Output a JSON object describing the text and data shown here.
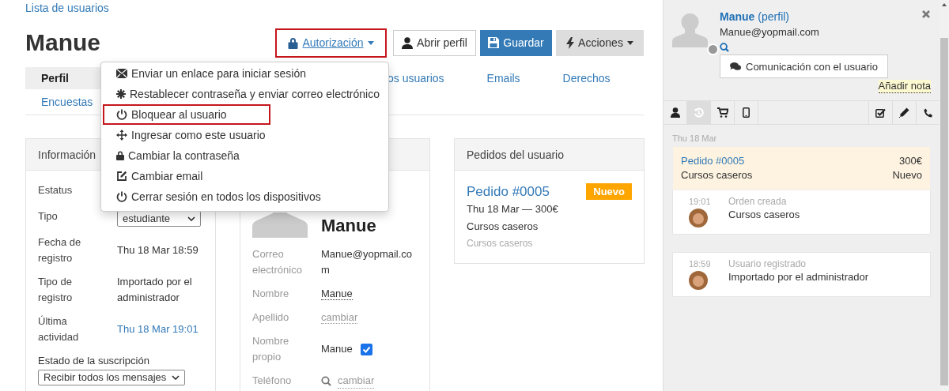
{
  "breadcrumb": "Lista de usuarios",
  "title": "Manue",
  "header_buttons": [
    {
      "label": "Autorización",
      "kind": "link",
      "highlighted": true
    },
    {
      "label": "Abrir perfil",
      "kind": "default"
    },
    {
      "label": "Guardar",
      "kind": "primary"
    },
    {
      "label": "Acciones",
      "kind": "dropdown"
    }
  ],
  "tabs": [
    {
      "label": "Perfil",
      "selected": true
    },
    {
      "label": "os usuarios",
      "selected": false
    },
    {
      "label": "Emails",
      "selected": false
    },
    {
      "label": "Derechos",
      "selected": false
    },
    {
      "label": "Encuestas",
      "selected": false
    }
  ],
  "dropdown_menu": [
    {
      "label": "Enviar un enlace para iniciar sesión",
      "kind": "send_link",
      "highlighted": false
    },
    {
      "label": "Restablecer contraseña y enviar correo electrónico",
      "kind": "reset_password",
      "highlighted": false
    },
    {
      "label": "Bloquear al usuario",
      "kind": "block",
      "highlighted": true
    },
    {
      "label": "Ingresar como este usuario",
      "kind": "impersonate",
      "highlighted": false
    },
    {
      "label": "Cambiar la contraseña",
      "kind": "change_password",
      "highlighted": false
    },
    {
      "label": "Cambiar email",
      "kind": "change_email",
      "highlighted": false
    },
    {
      "label": "Cerrar sesión en todos los dispositivos",
      "kind": "logout",
      "highlighted": false
    }
  ],
  "info_card": {
    "title": "Información",
    "rows": [
      {
        "label": "Estatus",
        "kind": "hidden"
      },
      {
        "label": "Tipo",
        "kind": "select",
        "value": "estudiante"
      },
      {
        "label": "Fecha de registro",
        "kind": "text",
        "value": "Thu 18 Mar 18:59"
      },
      {
        "label": "Tipo de registro",
        "kind": "text",
        "value": "Importado por el administrador"
      },
      {
        "label": "Última actividad",
        "kind": "link",
        "value": "Thu 18 Mar 19:01"
      }
    ],
    "subscription": {
      "label": "Estado de la suscripción",
      "value": "Recibir todos los mensajes"
    }
  },
  "contact_card": {
    "name": "Manue",
    "rows": [
      {
        "label": "Correo electrónico",
        "kind": "text",
        "value": "Manue@yopmail.com"
      },
      {
        "label": "Nombre",
        "kind": "editable",
        "value": "Manue"
      },
      {
        "label": "Apellido",
        "kind": "empty",
        "value": "cambiar"
      },
      {
        "label": "Nombre propio",
        "kind": "checkbox",
        "value": "Manue",
        "checked": true
      },
      {
        "label": "Teléfono",
        "kind": "phone",
        "value": "cambiar"
      }
    ]
  },
  "orders_card": {
    "title": "Pedidos del usuario",
    "orders": [
      {
        "number": "Pedido #0005",
        "status": "Nuevo",
        "summary": "Thu 18 Mar — 300€",
        "product": "Cursos caseros",
        "category": "Cursos caseros"
      }
    ]
  },
  "profile_panel": {
    "name": "Manue",
    "profile_link": "(perfil)",
    "email": "Manue@yopmail.com",
    "online": false,
    "contact_button": "Comunicación con el usuario",
    "note_link": "Añadir nota",
    "left_tabs": [
      {
        "kind": "user",
        "selected": false
      },
      {
        "kind": "history",
        "selected": true
      },
      {
        "kind": "cart",
        "selected": false
      },
      {
        "kind": "mobile",
        "selected": false
      }
    ],
    "right_tabs": [
      {
        "kind": "tasks",
        "selected": false
      },
      {
        "kind": "edit",
        "selected": false
      },
      {
        "kind": "phone",
        "selected": false
      }
    ],
    "date": "Thu 18 Mar",
    "order": {
      "title": "Pedido #0005",
      "amount": "300€",
      "product": "Cursos caseros",
      "status": "Nuevo"
    },
    "events": [
      {
        "time": "19:01",
        "title": "Orden creada",
        "text": "Cursos caseros"
      },
      {
        "time": "18:59",
        "title": "Usuario registrado",
        "text": "Importado por el administrador"
      }
    ]
  }
}
